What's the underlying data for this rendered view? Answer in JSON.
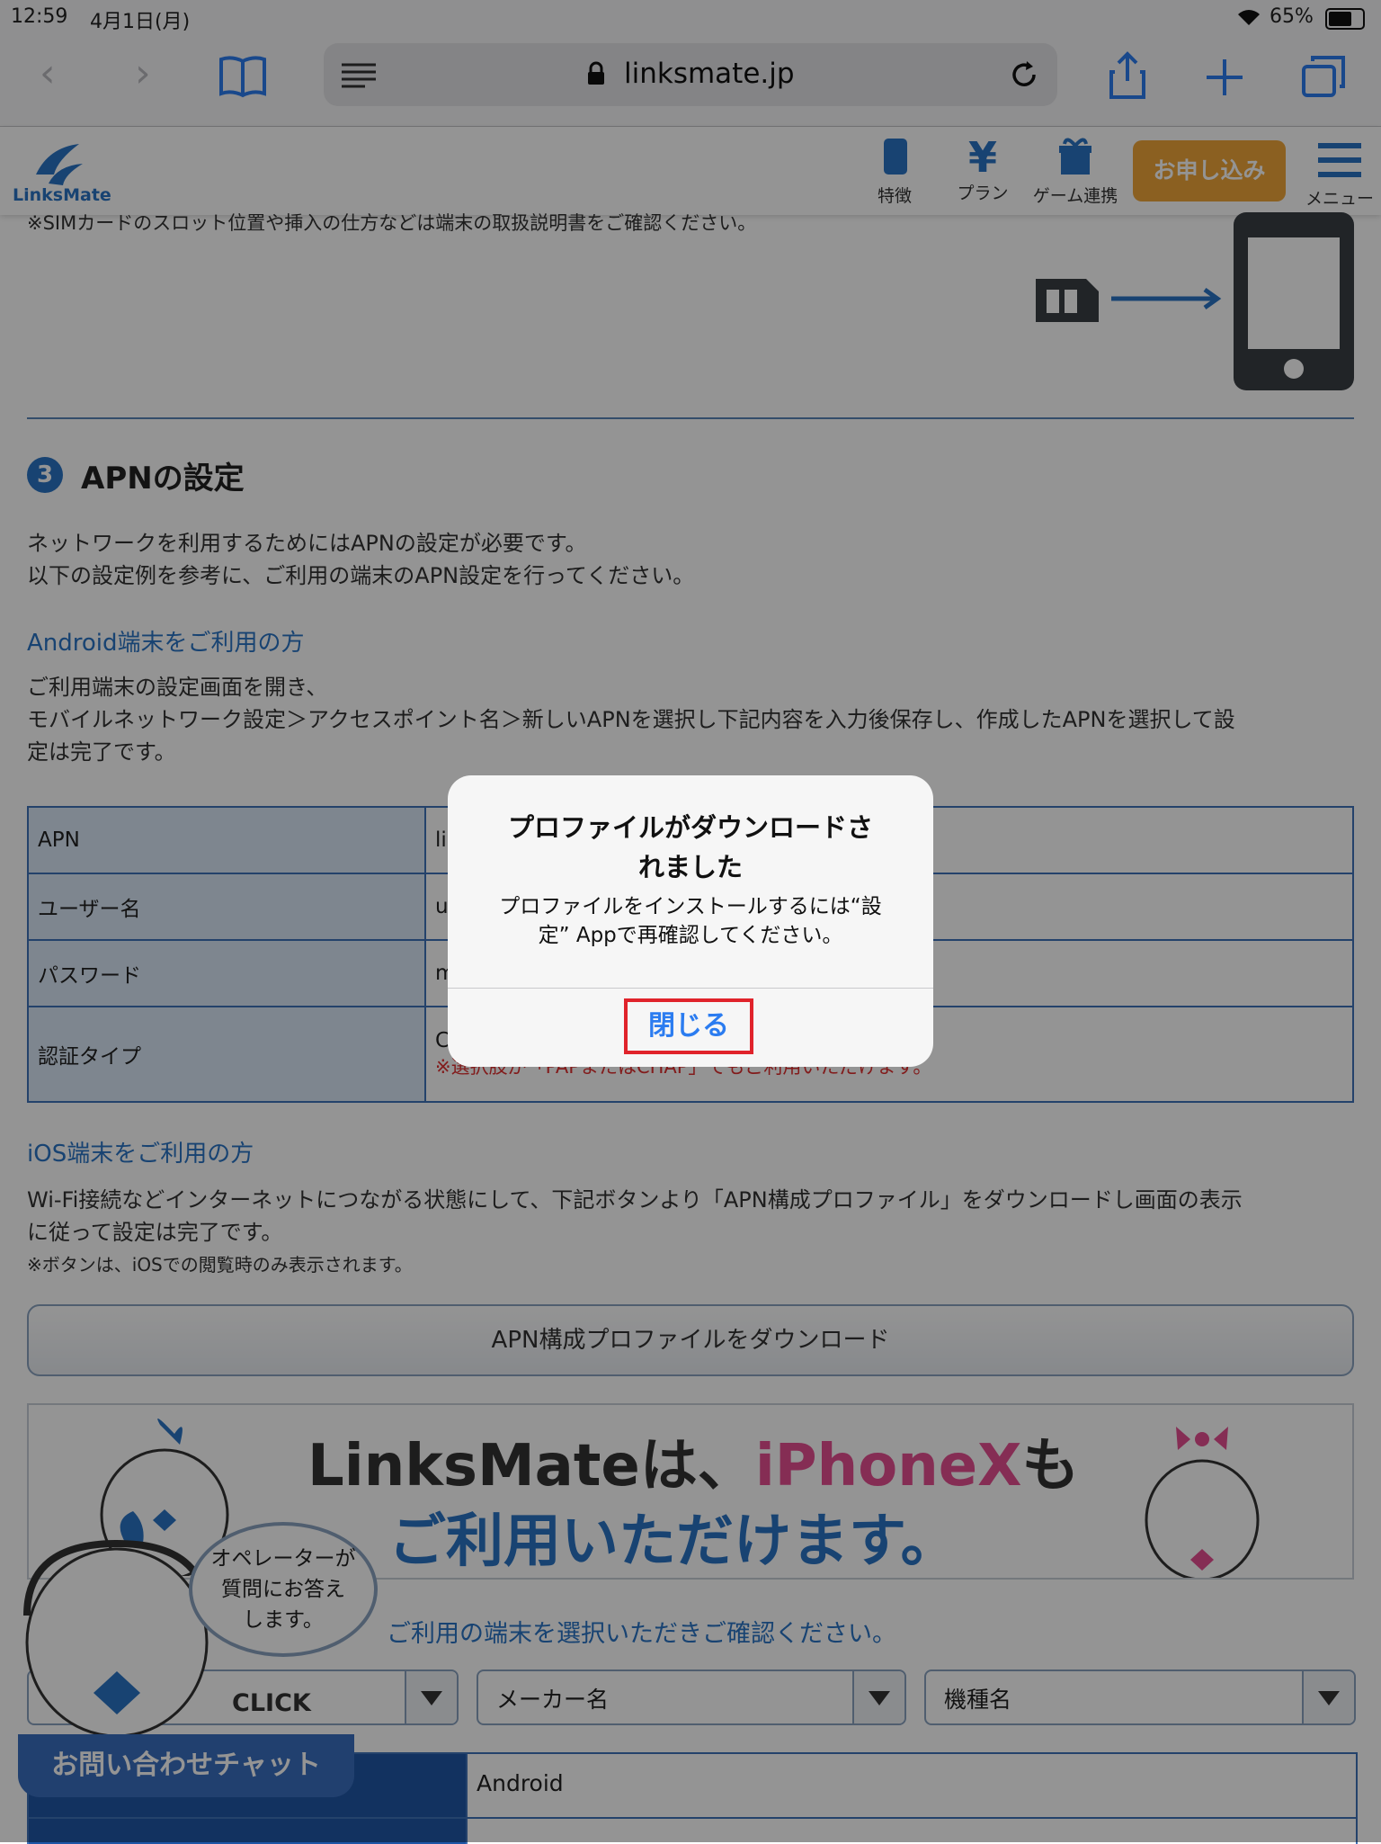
{
  "status_bar": {
    "time": "12:59",
    "date": "4月1日(月)",
    "battery": "65%"
  },
  "browser": {
    "url": "linksmate.jp"
  },
  "site": {
    "logo": "LinksMate",
    "nav": [
      {
        "label": "特徴",
        "icon": "phone-icon"
      },
      {
        "label": "プラン",
        "icon": "yen-icon"
      },
      {
        "label": "ゲーム連携",
        "icon": "gift-icon"
      }
    ],
    "apply_label": "お申し込み",
    "menu_label": "メニュー"
  },
  "sim_note": "※SIMカードのスロット位置や挿入の仕方などは端末の取扱説明書をご確認ください。",
  "section": {
    "number": "3",
    "title": "APNの設定",
    "intro": [
      "ネットワークを利用するためにはAPNの設定が必要です。",
      "以下の設定例を参考に、ご利用の端末のAPN設定を行ってください。"
    ],
    "android_heading": "Android端末をご利用の方",
    "android_text": [
      "ご利用端末の設定画面を開き、",
      "モバイルネットワーク設定＞アクセスポイント名＞新しいAPNを選択し下記内容を入力後保存し、作成したAPNを選択して設",
      "定は完了です。"
    ],
    "table": [
      {
        "label": "APN",
        "value": "li"
      },
      {
        "label": "ユーザー名",
        "value": "u"
      },
      {
        "label": "パスワード",
        "value": "m"
      },
      {
        "label": "認証タイプ",
        "value": "C",
        "note": "※選択肢が「PAPまたはCHAP」でもご利用いただけます。"
      }
    ],
    "ios_heading": "iOS端末をご利用の方",
    "ios_text": [
      "Wi-Fi接続などインターネットにつながる状態にして、下記ボタンより「APN構成プロファイル」をダウンロードし画面の表示",
      "に従って設定は完了です。"
    ],
    "ios_note": "※ボタンは、iOSでの閲覧時のみ表示されます。",
    "download_label": "APN構成プロファイルをダウンロード"
  },
  "banner": {
    "line1_a": "LinksMateは、",
    "line1_b": "iPhoneX",
    "line1_c": "も",
    "line2": "ご利用いただけます。"
  },
  "device_prompt": "ご利用の端末を選択いただきご確認ください。",
  "selects": {
    "maker": "メーカー名",
    "model": "機種名"
  },
  "device_row": "Android",
  "chat": {
    "bubble": [
      "オペレーターが",
      "質問にお答え",
      "します。"
    ],
    "click": "CLICK",
    "bar": "お問い合わせチャット"
  },
  "alert": {
    "title_1": "プロファイルがダウンロードさ",
    "title_2": "れました",
    "message_1": "プロファイルをインストールするには“設",
    "message_2": "定” Appで再確認してください。",
    "close_label": "閉じる"
  }
}
